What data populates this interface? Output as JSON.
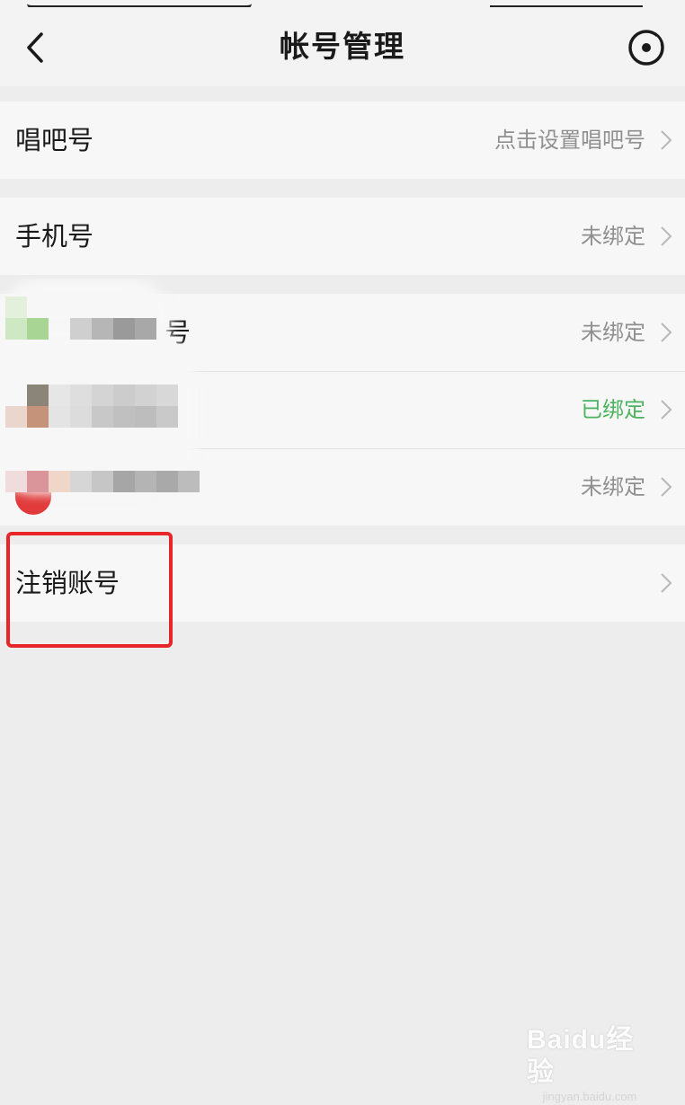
{
  "header": {
    "title": "帐号管理",
    "back_icon": "chevron-left-icon",
    "more_icon": "circle-dot-menu-icon"
  },
  "rows": [
    {
      "label": "唱吧号",
      "value": "点击设置唱吧号",
      "status": "unset"
    },
    {
      "label": "手机号",
      "value": "未绑定",
      "status": "unbound"
    },
    {
      "label": "号",
      "value": "未绑定",
      "status": "unbound",
      "label_partially_obscured": true
    },
    {
      "label": "",
      "value": "已绑定",
      "status": "bound",
      "label_obscured": true
    },
    {
      "label": "",
      "value": "未绑定",
      "status": "unbound",
      "label_obscured": true
    },
    {
      "label": "注销账号",
      "value": "",
      "status": "action"
    }
  ],
  "colors": {
    "accent_bound": "#4cb35e",
    "highlight": "#e8262a",
    "value_gray": "#8f8f8f"
  },
  "watermark": {
    "logo": "Baidu经验",
    "url": "jingyan.baidu.com"
  }
}
